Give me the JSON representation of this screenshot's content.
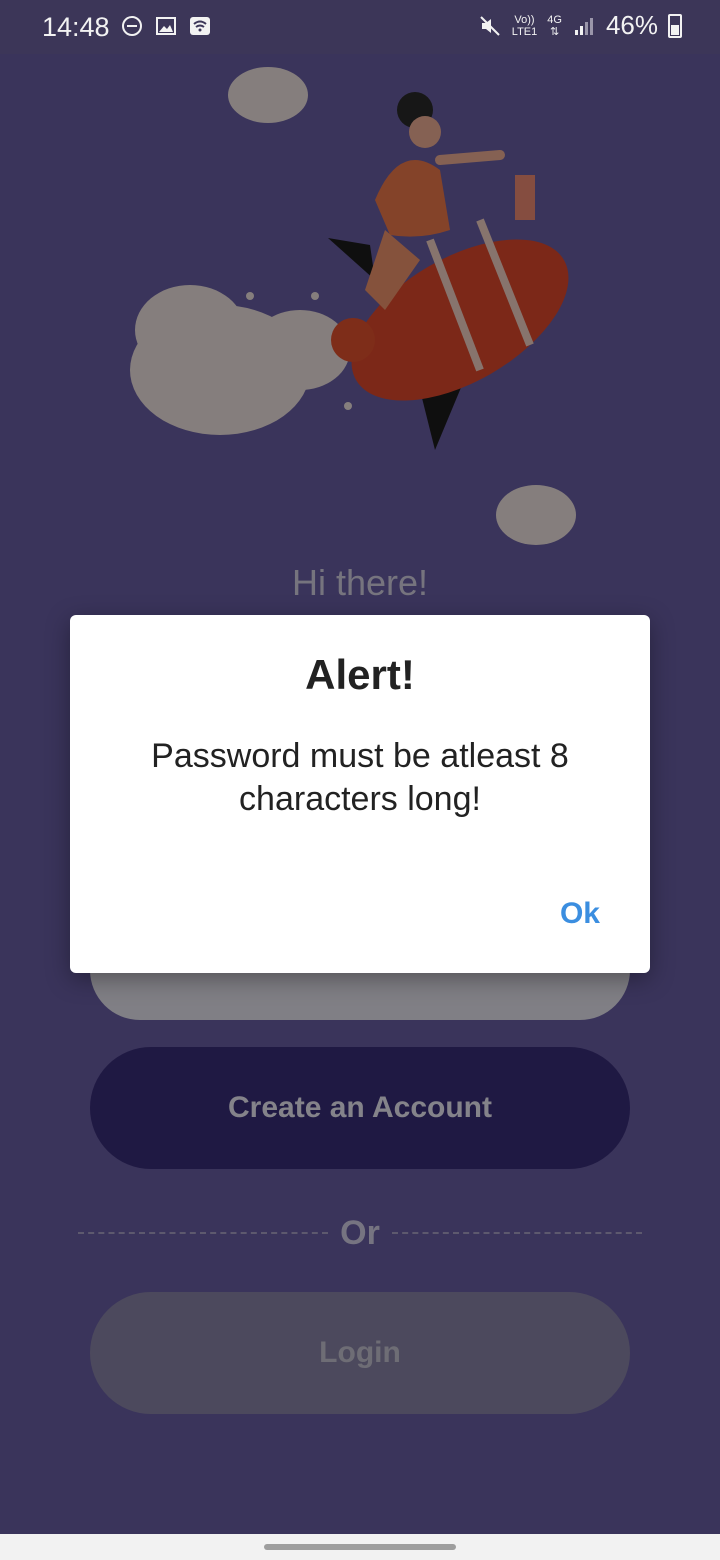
{
  "status_bar": {
    "time": "14:48",
    "volte_label": "Vo))",
    "lte_label": "LTE1",
    "network_label": "4G",
    "battery_percent": "46%",
    "icons": [
      "dnd-icon",
      "image-icon",
      "wifi-icon",
      "mute-icon",
      "signal-icon",
      "battery-icon"
    ]
  },
  "screen": {
    "greeting": "Hi there!",
    "create_button": "Create an Account",
    "divider_text": "Or",
    "login_button": "Login"
  },
  "dialog": {
    "title": "Alert!",
    "message": "Password must be atleast 8 characters long!",
    "ok_label": "Ok"
  },
  "colors": {
    "background": "#6a5fa6",
    "primary_button": "#3a2e7a",
    "dialog_action": "#3b8ee0"
  }
}
